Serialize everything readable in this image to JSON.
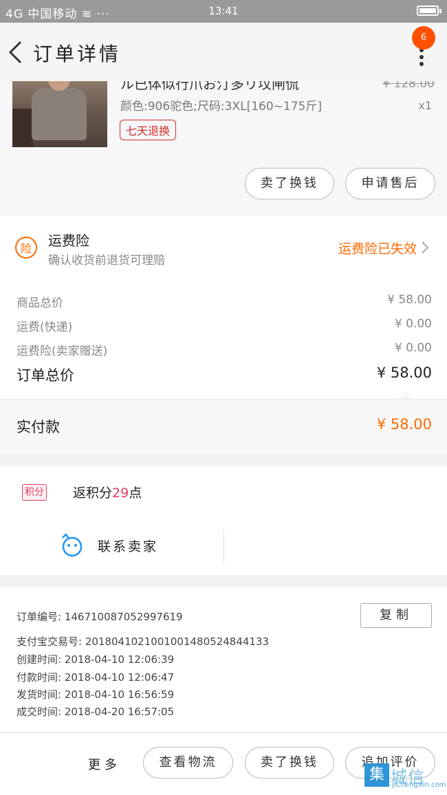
{
  "status_bar": {
    "signal": "4G",
    "carrier": "中国移动",
    "dots": "···",
    "time": "13:41"
  },
  "nav": {
    "title": "订单详情",
    "badge": "6"
  },
  "product": {
    "title_cut": "ル已体似行爪お汀多リ坟闸侃",
    "spec": "颜色:906驼色;尺码:3XL[160~175斤]",
    "tag": "七天退换",
    "orig_price": "¥ 128.00",
    "qty": "x1",
    "btn_return": "卖了换钱",
    "btn_aftersale": "申请售后"
  },
  "insurance": {
    "icon_char": "险",
    "title": "运费险",
    "desc": "确认收货前退货可理赔",
    "status": "运费险已失效"
  },
  "prices": {
    "goods_label": "商品总价",
    "goods_value": "¥ 58.00",
    "shipping_label": "运费(快递)",
    "shipping_value": "¥ 0.00",
    "ins_label": "运费险(卖家赠送)",
    "ins_value": "¥ 0.00",
    "total_label": "订单总价",
    "total_value": "¥ 58.00",
    "paid_label": "实付款",
    "paid_value": "¥ 58.00"
  },
  "points": {
    "badge": "积分",
    "prefix": "返积分",
    "num": "29",
    "suffix": "点"
  },
  "contact": {
    "label": "联系卖家"
  },
  "order_info": {
    "order_no": "订单编号:  146710087052997619",
    "alipay_no": "支付宝交易号:  2018041021001001480524844133",
    "created": "创建时间:  2018-04-10 12:06:39",
    "paid": "付款时间:  2018-04-10 12:06:47",
    "shipped": "发货时间:  2018-04-10 16:56:59",
    "completed": "成交时间:  2018-04-20 16:57:05",
    "copy_label": "复制"
  },
  "bottom": {
    "more": "更多",
    "logistics": "查看物流",
    "return": "卖了换钱",
    "review": "追加评价"
  },
  "watermark": {
    "mark": "集",
    "text": "城信",
    "url": "JiChengXin.com"
  }
}
